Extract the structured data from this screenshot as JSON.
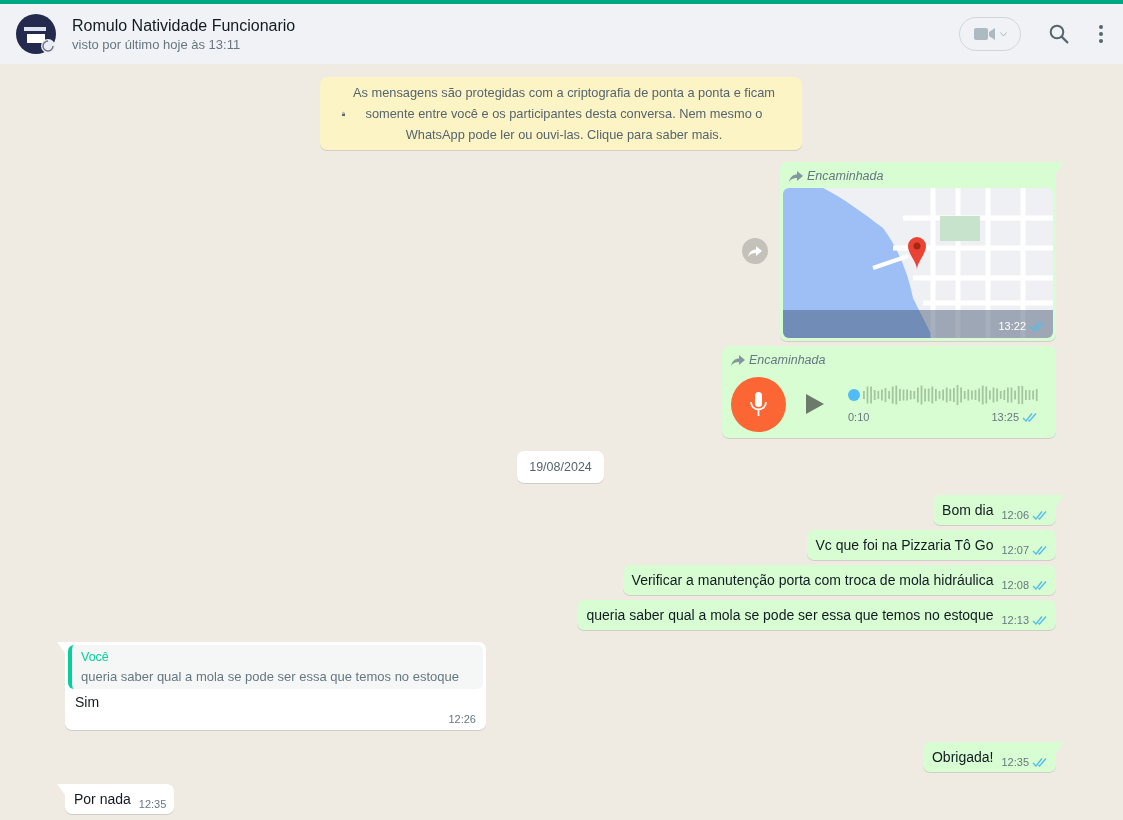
{
  "header": {
    "name": "Romulo Natividade Funcionario",
    "status": "visto por último hoje às 13:11"
  },
  "encryption_notice": "As mensagens são protegidas com a criptografia de ponta a ponta e ficam somente entre você e os participantes desta conversa. Nem mesmo o WhatsApp pode ler ou ouvi-las. Clique para saber mais.",
  "items": [
    {
      "kind": "location",
      "outgoing": true,
      "tail": true,
      "forwarded": true,
      "forwarded_label": "Encaminhada",
      "time": "13:22",
      "read": true
    },
    {
      "kind": "audio",
      "outgoing": true,
      "tail": false,
      "forwarded": true,
      "forwarded_label": "Encaminhada",
      "duration": "0:10",
      "time": "13:25",
      "read": true
    },
    {
      "kind": "date",
      "text": "19/08/2024"
    },
    {
      "kind": "text",
      "outgoing": true,
      "tail": true,
      "text": "Bom dia",
      "time": "12:06",
      "read": true
    },
    {
      "kind": "text",
      "outgoing": true,
      "tail": false,
      "text": "Vc que foi na Pizzaria Tô Go",
      "time": "12:07",
      "read": true
    },
    {
      "kind": "text",
      "outgoing": true,
      "tail": false,
      "text": "Verificar a manutenção porta com troca de mola hidráulica",
      "time": "12:08",
      "read": true
    },
    {
      "kind": "text",
      "outgoing": true,
      "tail": false,
      "text": "queria saber qual a mola se pode ser essa que temos no estoque",
      "time": "12:13",
      "read": true
    },
    {
      "kind": "reply",
      "outgoing": false,
      "tail": true,
      "quote_author": "Você",
      "quote_text": "queria saber qual a mola se pode ser essa que temos no estoque",
      "text": "Sim",
      "time": "12:26"
    },
    {
      "kind": "text",
      "outgoing": true,
      "tail": true,
      "text": "Obrigada!",
      "time": "12:35",
      "read": true
    },
    {
      "kind": "text",
      "outgoing": false,
      "tail": true,
      "text": "Por nada",
      "time": "12:35"
    }
  ]
}
